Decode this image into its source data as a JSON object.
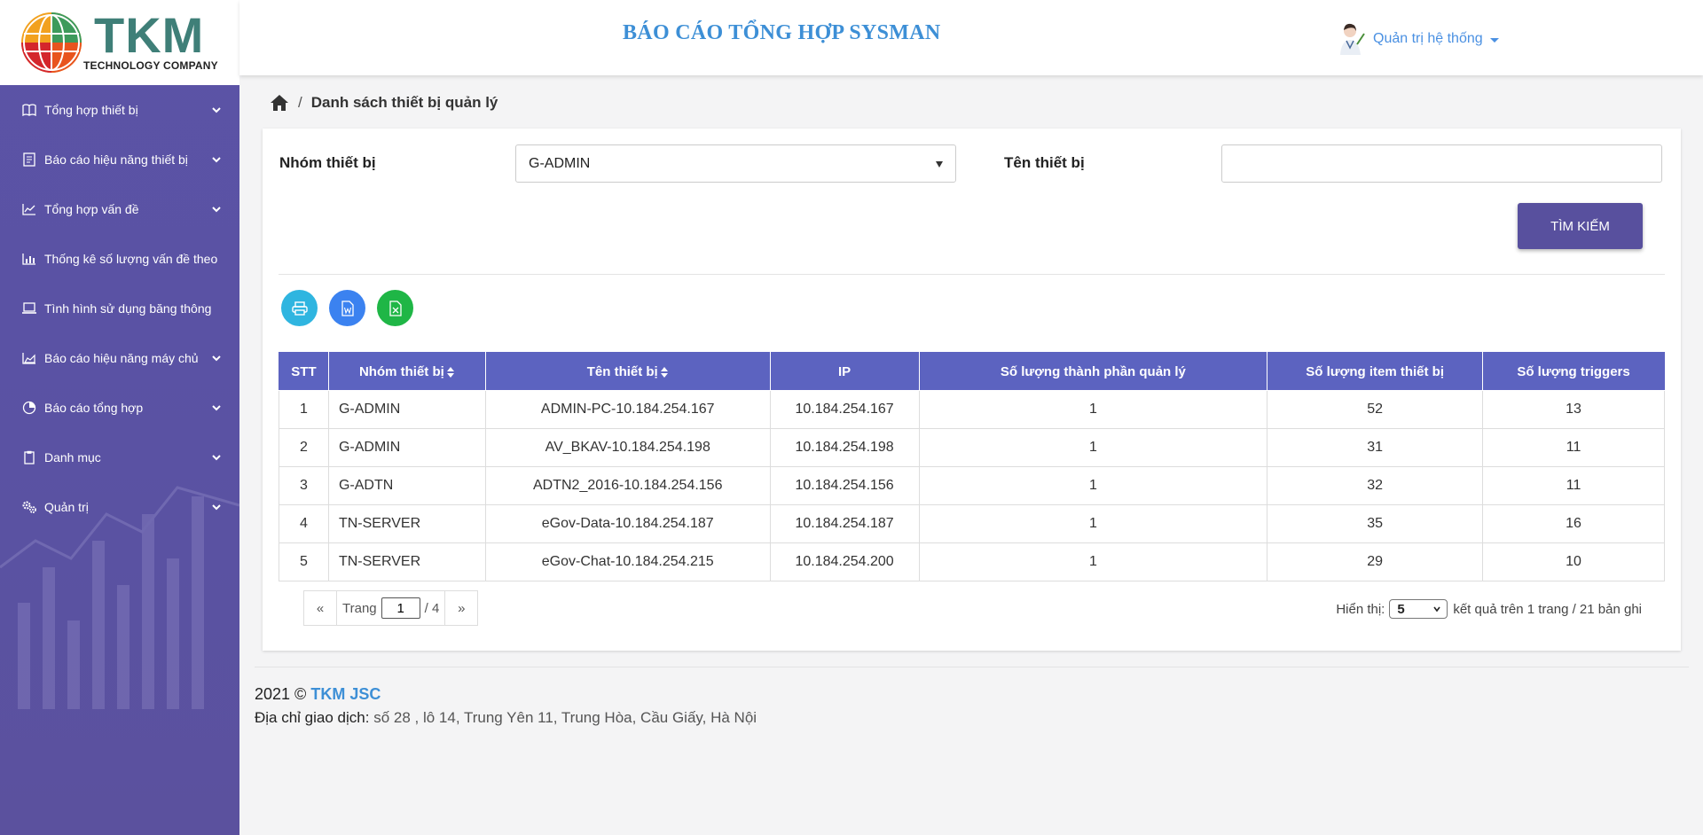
{
  "logo": {
    "name": "TKM",
    "subtitle": "TECHNOLOGY COMPANY"
  },
  "sidebar": {
    "items": [
      {
        "label": "Tổng hợp thiết bị",
        "icon": "book-icon",
        "expandable": true
      },
      {
        "label": "Báo cáo hiệu năng thiết bị",
        "icon": "report-icon",
        "expandable": true
      },
      {
        "label": "Tổng hợp vấn đề",
        "icon": "line-chart-icon",
        "expandable": true
      },
      {
        "label": "Thống kê số lượng vấn đề theo",
        "icon": "bar-chart-icon",
        "expandable": false
      },
      {
        "label": "Tình hình sử dụng băng thông",
        "icon": "laptop-icon",
        "expandable": false
      },
      {
        "label": "Báo cáo hiệu năng máy chủ",
        "icon": "area-chart-icon",
        "expandable": true
      },
      {
        "label": "Báo cáo tổng hợp",
        "icon": "pie-chart-icon",
        "expandable": true
      },
      {
        "label": "Danh mục",
        "icon": "clipboard-icon",
        "expandable": true
      },
      {
        "label": "Quản trị",
        "icon": "gears-icon",
        "expandable": true
      }
    ]
  },
  "header": {
    "title": "BÁO CÁO TỔNG HỢP SYSMAN",
    "user_label": "Quản trị hệ thống"
  },
  "breadcrumb": {
    "current": "Danh sách thiết bị quản lý"
  },
  "filters": {
    "group_label": "Nhóm thiết bị",
    "group_value": "G-ADMIN",
    "name_label": "Tên thiết bị",
    "name_value": "",
    "search_button": "TÌM KIẾM"
  },
  "export_buttons": [
    {
      "icon": "print-icon",
      "color": "#2fb5e0"
    },
    {
      "icon": "word-icon",
      "color": "#3b82f0"
    },
    {
      "icon": "excel-icon",
      "color": "#1fb646"
    }
  ],
  "table": {
    "columns": [
      "STT",
      "Nhóm thiết bị",
      "Tên thiết bị",
      "IP",
      "Số lượng thành phần quản lý",
      "Số lượng item thiết bị",
      "Số lượng triggers"
    ],
    "rows": [
      [
        "1",
        "G-ADMIN",
        "ADMIN-PC-10.184.254.167",
        "10.184.254.167",
        "1",
        "52",
        "13"
      ],
      [
        "2",
        "G-ADMIN",
        "AV_BKAV-10.184.254.198",
        "10.184.254.198",
        "1",
        "31",
        "11"
      ],
      [
        "3",
        "G-ADTN",
        "ADTN2_2016-10.184.254.156",
        "10.184.254.156",
        "1",
        "32",
        "11"
      ],
      [
        "4",
        "TN-SERVER",
        "eGov-Data-10.184.254.187",
        "10.184.254.187",
        "1",
        "35",
        "16"
      ],
      [
        "5",
        "TN-SERVER",
        "eGov-Chat-10.184.254.215",
        "10.184.254.200",
        "1",
        "29",
        "10"
      ]
    ]
  },
  "pagination": {
    "prev": "«",
    "next": "»",
    "page_label": "Trang",
    "current_page": "1",
    "total_pages": "/ 4",
    "show_label": "Hiển thị:",
    "page_size": "5",
    "summary": "kết quả trên 1 trang / 21 bản ghi"
  },
  "footer": {
    "copyright": "2021 ©",
    "brand": "TKM JSC",
    "address_label": "Địa chỉ giao dịch:",
    "address": "số 28 , lô 14, Trung Yên 11, Trung Hòa, Cầu Giấy, Hà Nội"
  },
  "colors": {
    "sidebar_bg": "#5a52a3",
    "table_header": "#5c63c0",
    "search_button": "#58509e",
    "title_blue": "#3d8fd6"
  }
}
